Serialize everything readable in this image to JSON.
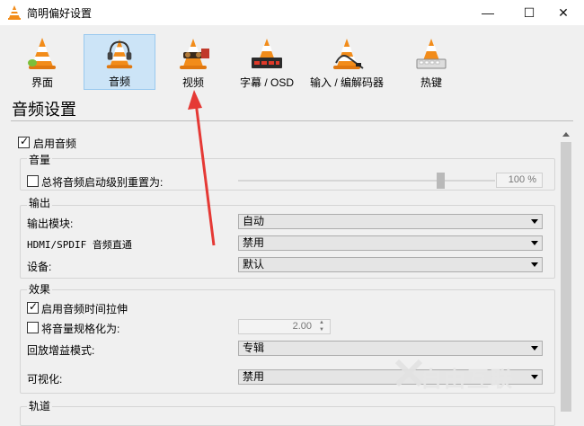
{
  "window": {
    "title": "简明偏好设置",
    "controls": {
      "minimize": "—",
      "maximize": "☐",
      "close": "✕"
    }
  },
  "toolbar": {
    "items": [
      {
        "label": "界面",
        "icon": "vlc-cone-icon"
      },
      {
        "label": "音频",
        "icon": "vlc-cone-headphones-icon",
        "selected": true
      },
      {
        "label": "视频",
        "icon": "vlc-cone-glasses-icon"
      },
      {
        "label": "字幕 / OSD",
        "icon": "vlc-cone-subtitle-icon"
      },
      {
        "label": "输入 / 编解码器",
        "icon": "vlc-cone-cable-icon"
      },
      {
        "label": "热键",
        "icon": "vlc-cone-keyboard-icon"
      }
    ]
  },
  "section_title": "音频设置",
  "audio": {
    "enable_audio": {
      "label": "启用音频",
      "checked": true
    },
    "volume_group": {
      "title": "音量",
      "reset_on_start": {
        "label": "总将音频启动级别重置为:",
        "checked": false
      },
      "level_value": "100 %"
    },
    "output_group": {
      "title": "输出",
      "output_module_label": "输出模块:",
      "output_module_value": "自动",
      "passthrough_label": "HDMI/SPDIF 音频直通",
      "passthrough_value": "禁用",
      "device_label": "设备:",
      "device_value": "默认"
    },
    "effects_group": {
      "title": "效果",
      "time_stretch": {
        "label": "启用音频时间拉伸",
        "checked": true
      },
      "normalize": {
        "label": "将音量规格化为:",
        "checked": false
      },
      "normalize_value": "2.00",
      "replay_gain_label": "回放增益模式:",
      "replay_gain_value": "专辑",
      "visualization_label": "可视化:",
      "visualization_value": "禁用"
    },
    "tracks_group": {
      "title": "轨道"
    }
  },
  "watermark": "自由互联"
}
